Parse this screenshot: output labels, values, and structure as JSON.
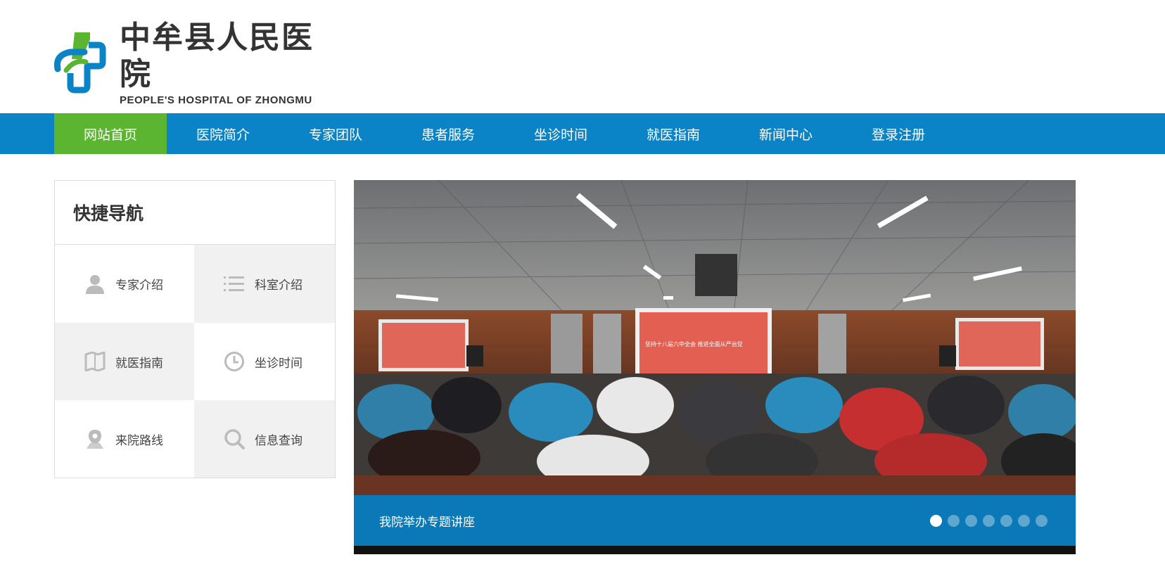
{
  "logo": {
    "name_cn": "中牟县人民医院",
    "name_en": "PEOPLE'S HOSPITAL OF  ZHONGMU",
    "icon": "hospital-cross-logo"
  },
  "nav": {
    "items": [
      {
        "label": "网站首页",
        "active": true
      },
      {
        "label": "医院简介"
      },
      {
        "label": "专家团队"
      },
      {
        "label": "患者服务"
      },
      {
        "label": "坐诊时间"
      },
      {
        "label": "就医指南"
      },
      {
        "label": "新闻中心"
      },
      {
        "label": "登录注册"
      }
    ]
  },
  "quick_nav": {
    "title": "快捷导航",
    "items": [
      {
        "label": "专家介绍",
        "icon": "person-icon"
      },
      {
        "label": "科室介绍",
        "icon": "list-icon"
      },
      {
        "label": "就医指南",
        "icon": "book-icon"
      },
      {
        "label": "坐诊时间",
        "icon": "clock-icon"
      },
      {
        "label": "来院路线",
        "icon": "location-pin-icon"
      },
      {
        "label": "信息查询",
        "icon": "search-icon"
      }
    ]
  },
  "slider": {
    "caption": "我院举办专题讲座",
    "slide_count": 7,
    "active_index": 0,
    "screen_text": "坚持十八届六中全会  推进全面从严治党"
  },
  "colors": {
    "nav_bg": "#0a84c6",
    "nav_active": "#5cb531",
    "caption_bg": "#087cbe"
  }
}
